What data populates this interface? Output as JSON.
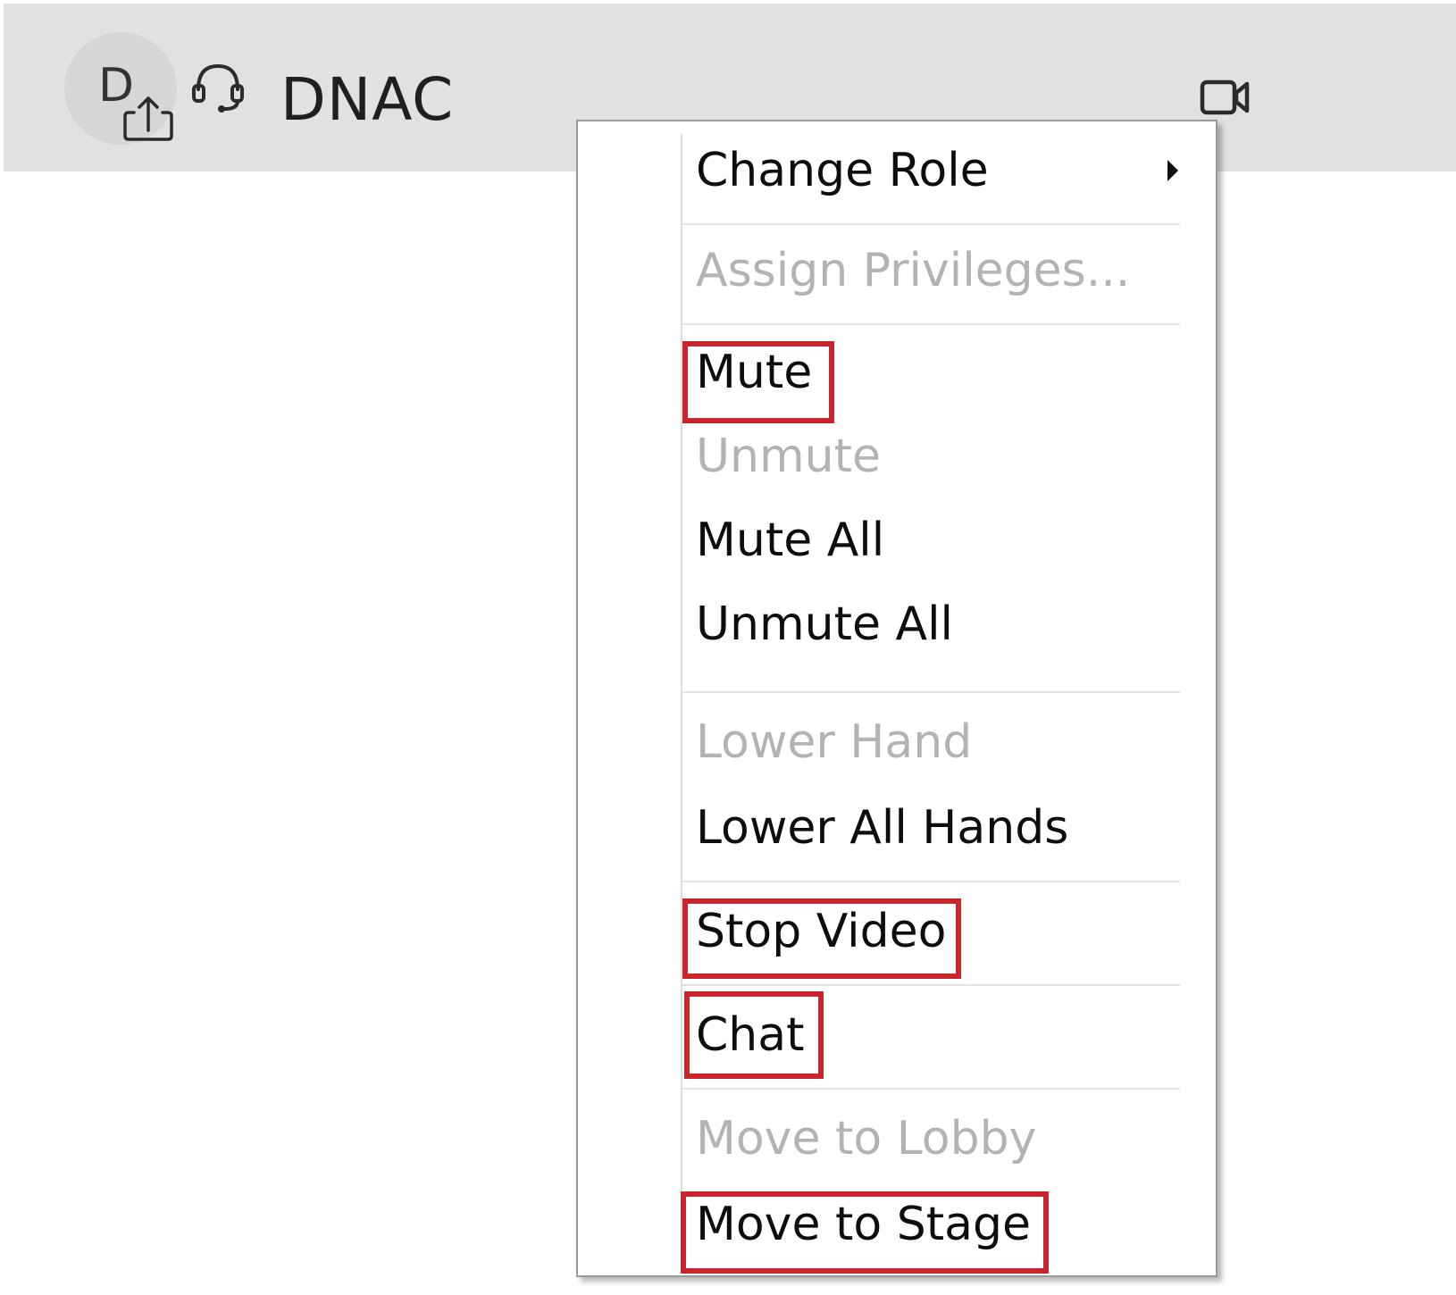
{
  "participant": {
    "avatar_initial": "D",
    "name": "DNAC"
  },
  "icons": {
    "avatar_badge": "share-screen-icon",
    "audio": "headset-icon",
    "video": "video-camera-icon",
    "submenu": "chevron-right-icon"
  },
  "menu": {
    "change_role": "Change Role",
    "assign_privileges": "Assign Privileges...",
    "mute": "Mute",
    "unmute": "Unmute",
    "mute_all": "Mute All",
    "unmute_all": "Unmute All",
    "lower_hand": "Lower Hand",
    "lower_all_hands": "Lower All Hands",
    "stop_video": "Stop Video",
    "chat": "Chat",
    "move_to_lobby": "Move to Lobby",
    "move_to_stage": "Move to Stage"
  },
  "menu_state": {
    "disabled_items": [
      "Assign Privileges...",
      "Unmute",
      "Lower Hand",
      "Move to Lobby"
    ],
    "highlighted_items": [
      "Mute",
      "Stop Video",
      "Chat",
      "Move to Stage"
    ]
  },
  "colors": {
    "highlight": "#c9252c",
    "disabled_text": "#b3b3b3",
    "header_bg": "#e1e1e1"
  }
}
